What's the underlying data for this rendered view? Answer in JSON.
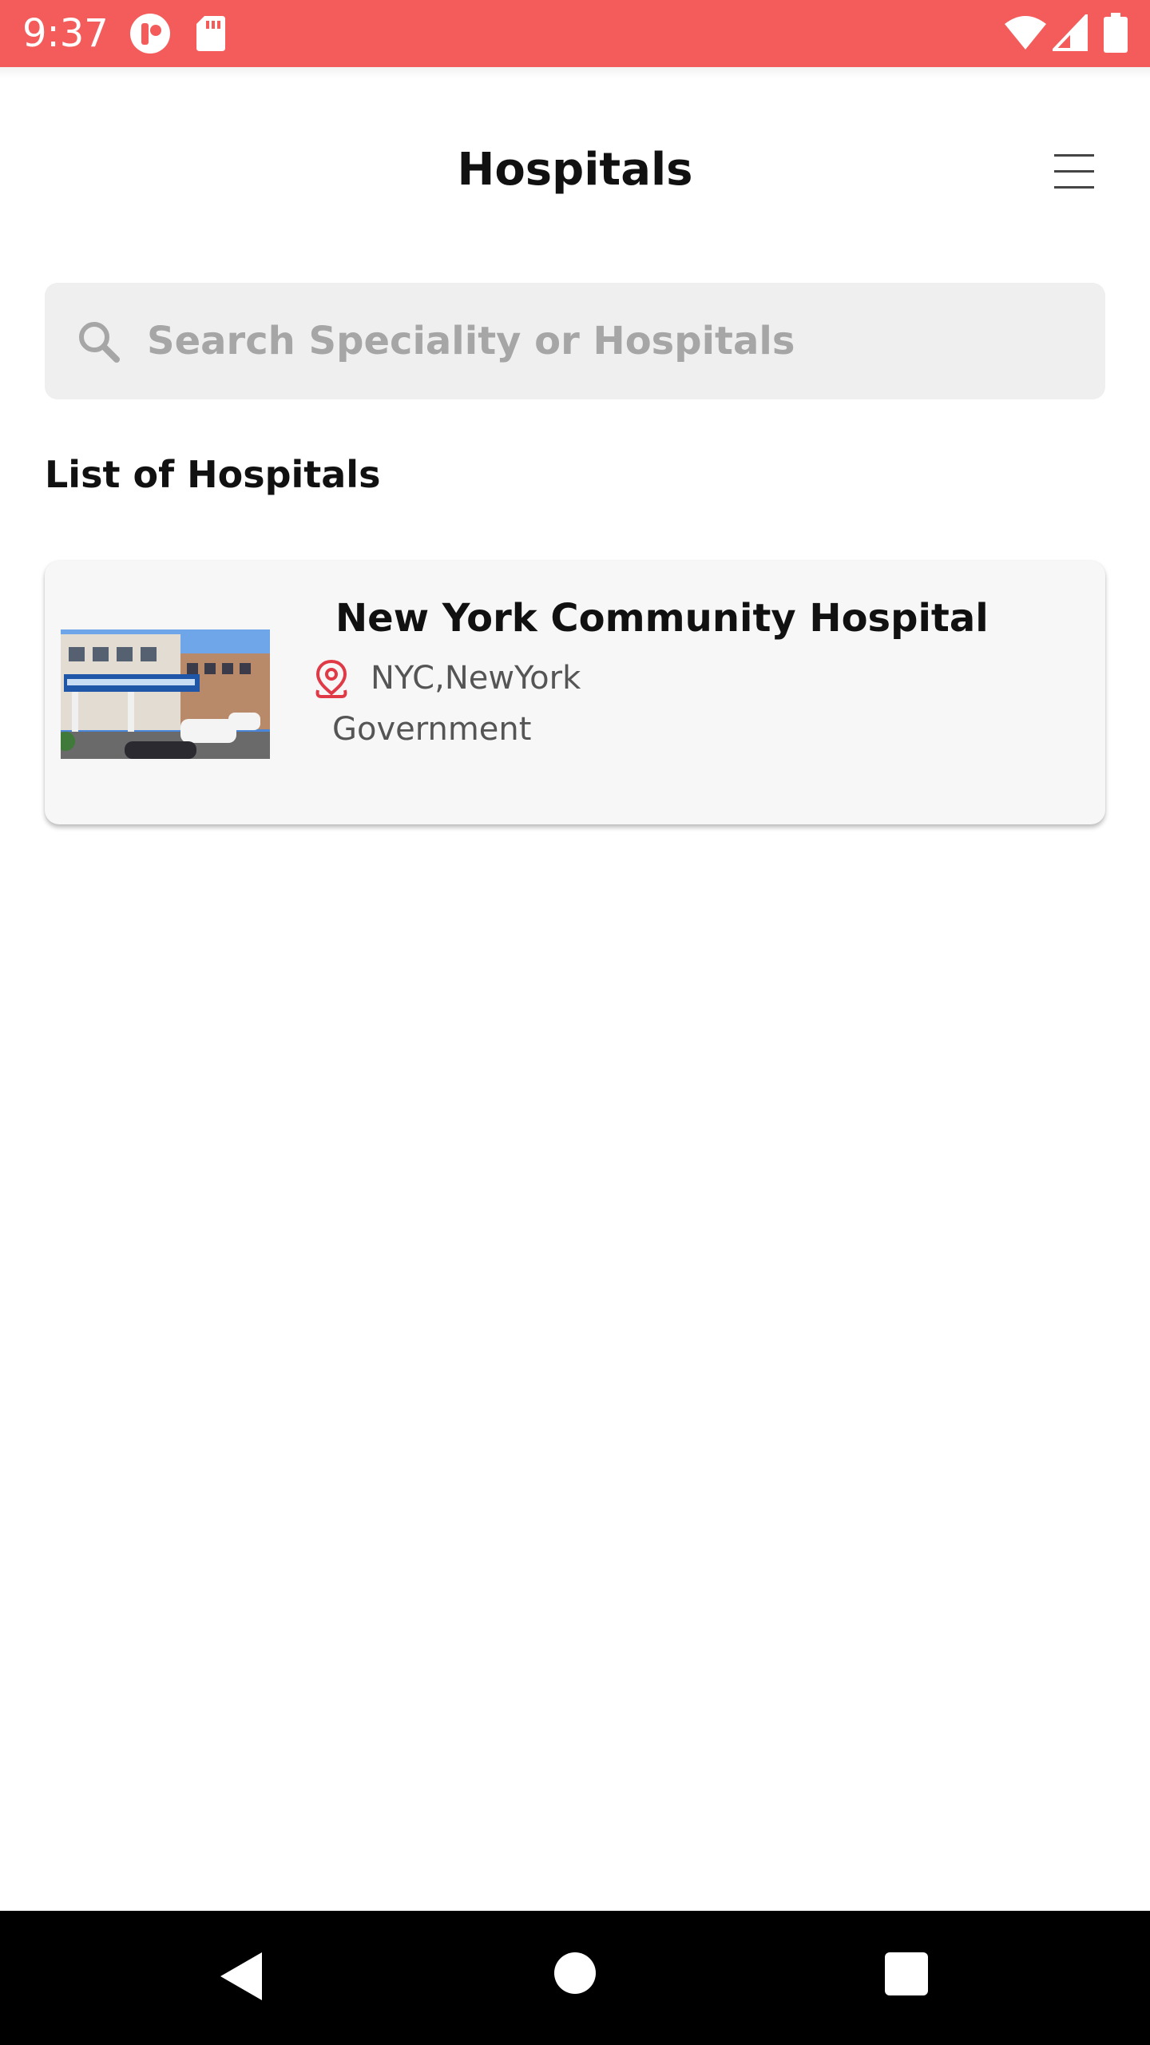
{
  "status_bar": {
    "time": "9:37",
    "background_color": "#f45c5c",
    "icons": [
      "app-notification-icon",
      "sd-card-icon",
      "wifi-icon",
      "cell-signal-icon",
      "battery-icon"
    ]
  },
  "header": {
    "title": "Hospitals",
    "menu_icon": "hamburger-menu-icon"
  },
  "search": {
    "placeholder": "Search Speciality or Hospitals",
    "value": "",
    "icon": "search-icon"
  },
  "section": {
    "title": "List of Hospitals"
  },
  "hospitals": [
    {
      "name": "New York Community Hospital",
      "location": "NYC,NewYork",
      "type": "Government",
      "location_icon": "map-pin-icon",
      "accent_color": "#e03a47"
    }
  ],
  "navigation_bar": {
    "buttons": [
      "back-icon",
      "home-icon",
      "recents-icon"
    ]
  }
}
